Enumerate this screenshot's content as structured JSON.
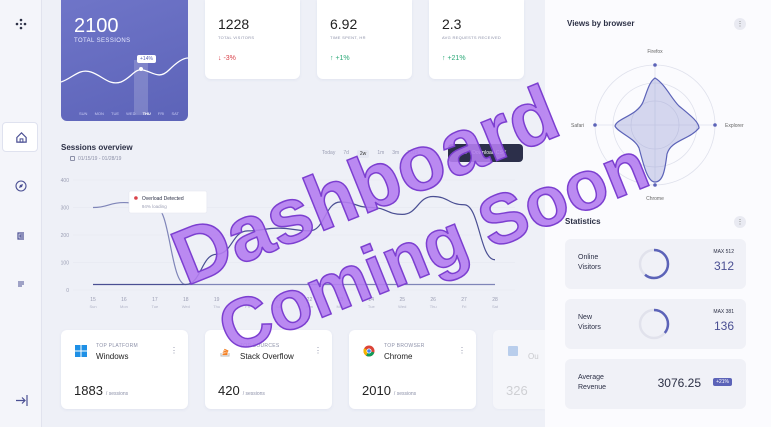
{
  "hero": {
    "total": "2100",
    "label": "TOTAL SESSIONS",
    "tag": "+14%",
    "days": [
      "SUN",
      "MON",
      "TUE",
      "WED",
      "THU",
      "FRI",
      "SAT"
    ]
  },
  "stats": [
    {
      "value": "1228",
      "label": "TOTAL VISITORS",
      "delta": "-3%"
    },
    {
      "value": "6.92",
      "label": "TIME SPENT, HR",
      "delta": "+1%"
    },
    {
      "value": "2.3",
      "label": "AVG REQUESTS RECEIVED",
      "delta": "+21%"
    }
  ],
  "sessions": {
    "title": "Sessions overview",
    "date_range": "01/15/19 - 01/28/19",
    "tabs": [
      "Today",
      "7d",
      "2w",
      "1m",
      "3m",
      "2019"
    ],
    "active_tab": "2w",
    "csv_label": "Download CSV",
    "alert_title": "Overload Detected",
    "alert_sub": "94% loading",
    "y_ticks": [
      "400",
      "300",
      "200",
      "100",
      "0"
    ],
    "x_days": [
      "15",
      "16",
      "17",
      "18",
      "19",
      "20",
      "21",
      "22",
      "23",
      "24",
      "25",
      "26",
      "27",
      "28"
    ],
    "x_weekdays": [
      "Sun",
      "Mon",
      "Tue",
      "Wed",
      "Thu",
      "Fri",
      "Sat",
      "Sun",
      "Mon",
      "Tue",
      "Wed",
      "Thu",
      "Fri",
      "Sat"
    ]
  },
  "chart_data": {
    "type": "line",
    "x": [
      "15",
      "16",
      "17",
      "18",
      "19",
      "20",
      "21",
      "22",
      "23",
      "24",
      "25",
      "26",
      "27",
      "28"
    ],
    "ylim": [
      0,
      400
    ],
    "series": [
      {
        "values": [
          300,
          318,
          305,
          20,
          20,
          20,
          20,
          20,
          20,
          20,
          20,
          20,
          20,
          20
        ]
      },
      {
        "values": [
          20,
          20,
          20,
          20,
          130,
          215,
          225,
          215,
          320,
          300,
          275,
          340,
          310,
          110
        ]
      }
    ],
    "alert_point": 17
  },
  "bottom": [
    {
      "caption": "TOP PLATFORM",
      "name": "Windows",
      "num": "1883",
      "unit": "/ sessions"
    },
    {
      "caption": "TOP SOURCES",
      "name": "Stack Overflow",
      "num": "420",
      "unit": "/ sessions"
    },
    {
      "caption": "TOP BROWSER",
      "name": "Chrome",
      "num": "2010",
      "unit": "/ sessions"
    },
    {
      "caption": "",
      "name": "Ou",
      "num": "326",
      "unit": ""
    }
  ],
  "browser": {
    "title": "Views by browser",
    "labels": [
      "Firefox",
      "Explorer",
      "Chrome",
      "Safari"
    ]
  },
  "statistics": {
    "title": "Statistics",
    "items": [
      {
        "label1": "Online",
        "label2": "Visitors",
        "max": "MAX 512",
        "value": "312",
        "fraction": 0.61
      },
      {
        "label1": "New",
        "label2": "Visitors",
        "max": "MAX 381",
        "value": "136",
        "fraction": 0.36
      },
      {
        "label1": "Average",
        "label2": "Revenue",
        "value": "3076.25",
        "badge": "+21%"
      }
    ]
  },
  "overlay": {
    "line1": "Dashboard",
    "line2": "Coming Soon"
  },
  "colors": {
    "accent": "#5c63b8",
    "dark": "#2c2f4a",
    "overlay": "#b47df0"
  }
}
